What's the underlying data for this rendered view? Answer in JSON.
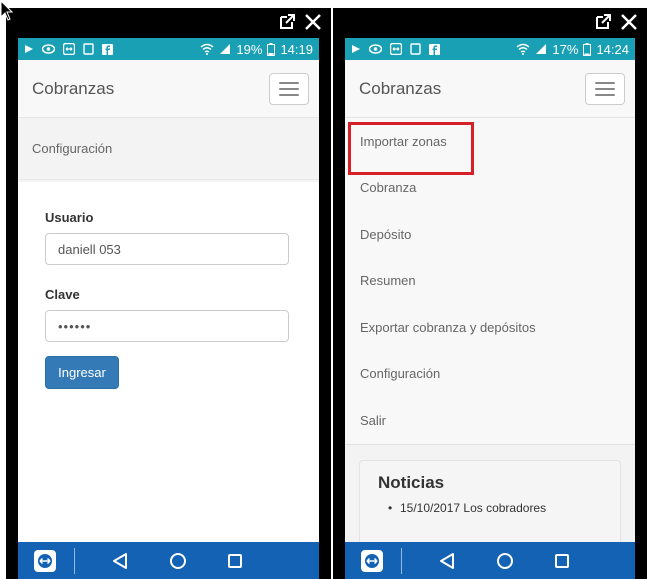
{
  "left_phone": {
    "status": {
      "battery": "19%",
      "time": "14:19"
    },
    "brand": "Cobranzas",
    "config_link": "Configuración",
    "form": {
      "user_label": "Usuario",
      "user_value": "daniell 053",
      "password_label": "Clave",
      "password_value": "••••••",
      "submit_label": "Ingresar"
    }
  },
  "right_phone": {
    "status": {
      "battery": "17%",
      "time": "14:24"
    },
    "brand": "Cobranzas",
    "menu": [
      {
        "label": "Importar zonas",
        "highlighted": true
      },
      {
        "label": "Cobranza"
      },
      {
        "label": "Depósito"
      },
      {
        "label": "Resumen"
      },
      {
        "label": "Exportar cobranza y depósitos"
      },
      {
        "label": "Configuración"
      },
      {
        "label": "Salir"
      }
    ],
    "news": {
      "title": "Noticias",
      "first_item": "15/10/2017 Los cobradores"
    }
  },
  "colors": {
    "status_bar": "#1aa0b4",
    "nav_bar": "#1462b3",
    "primary_button": "#337ab7",
    "highlight": "#d62027"
  },
  "icons": [
    "external-link-icon",
    "close-icon",
    "wifi-icon",
    "signal-icon",
    "battery-icon",
    "teamviewer-icon",
    "back-icon",
    "home-icon",
    "recents-icon",
    "menu-hamburger-icon"
  ]
}
